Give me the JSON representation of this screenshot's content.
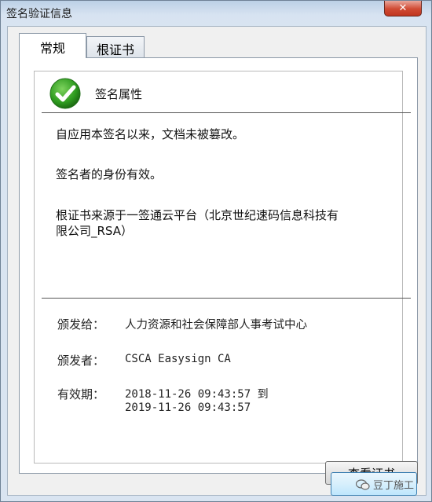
{
  "window": {
    "title": "签名验证信息",
    "close_glyph": "✕"
  },
  "tabs": [
    {
      "label": "常规"
    },
    {
      "label": "根证书"
    }
  ],
  "section": {
    "title": "签名属性"
  },
  "messages": [
    "自应用本签名以来，文档未被篡改。",
    "签名者的身份有效。",
    "根证书来源于一签通云平台（北京世纪速码信息科技有",
    "限公司_RSA）"
  ],
  "details": {
    "issued_to_label": "颁发给：",
    "issued_to_value": "人力资源和社会保障部人事考试中心",
    "issuer_label": "颁发者：",
    "issuer_value": "CSCA Easysign CA",
    "validity_label": "有效期：",
    "validity_from": "2018-11-26 09:43:57 到",
    "validity_to": "2019-11-26 09:43:57"
  },
  "buttons": {
    "view_cert": "查看证书"
  },
  "watermark": {
    "text": "豆丁施工"
  },
  "colors": {
    "check_green": "#2e9b1f",
    "titlebar": "#bcd0e6",
    "close_red": "#d04a33"
  }
}
